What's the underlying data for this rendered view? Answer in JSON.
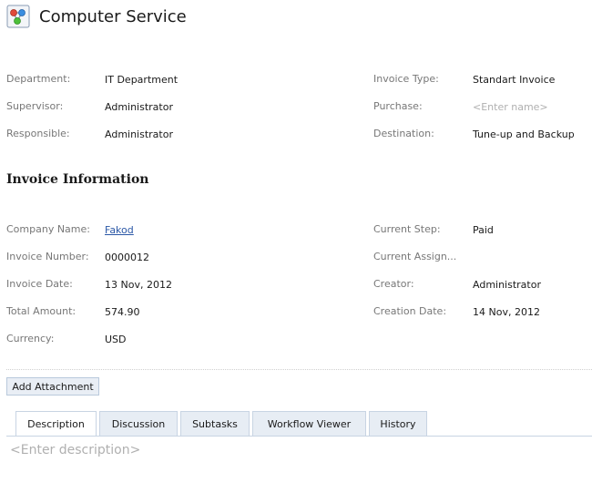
{
  "header": {
    "title": "Computer Service",
    "icon": "workflow-app-icon"
  },
  "fields_top": {
    "department": {
      "label": "Department:",
      "value": "IT Department"
    },
    "supervisor": {
      "label": "Supervisor:",
      "value": "Administrator"
    },
    "responsible": {
      "label": "Responsible:",
      "value": "Administrator"
    },
    "invoice_type": {
      "label": "Invoice Type:",
      "value": "Standart Invoice"
    },
    "purchase": {
      "label": "Purchase:",
      "placeholder": "<Enter name>"
    },
    "destination": {
      "label": "Destination:",
      "value": "Tune-up and Backup"
    }
  },
  "invoice_section": {
    "title": "Invoice Information",
    "company_name": {
      "label": "Company Name:",
      "value": "Fakod"
    },
    "invoice_number": {
      "label": "Invoice Number:",
      "value": "0000012"
    },
    "invoice_date": {
      "label": "Invoice Date:",
      "value": "13 Nov, 2012"
    },
    "total_amount": {
      "label": "Total Amount:",
      "value": "574.90"
    },
    "currency": {
      "label": "Currency:",
      "value": "USD"
    },
    "current_step": {
      "label": "Current Step:",
      "value": "Paid"
    },
    "current_assign": {
      "label": "Current Assign..."
    },
    "creator": {
      "label": "Creator:",
      "value": "Administrator"
    },
    "creation_date": {
      "label": "Creation Date:",
      "value": "14 Nov, 2012"
    }
  },
  "actions": {
    "add_attachment": "Add Attachment"
  },
  "tabs": [
    {
      "label": "Description",
      "active": true
    },
    {
      "label": "Discussion"
    },
    {
      "label": "Subtasks"
    },
    {
      "label": "Workflow Viewer"
    },
    {
      "label": "History"
    }
  ],
  "description": {
    "placeholder": "<Enter description>"
  },
  "colors": {
    "link": "#2a57a6",
    "tab_bg": "#e7edf4",
    "tab_border": "#c8d4e3",
    "button_bg": "#e9eef5"
  }
}
